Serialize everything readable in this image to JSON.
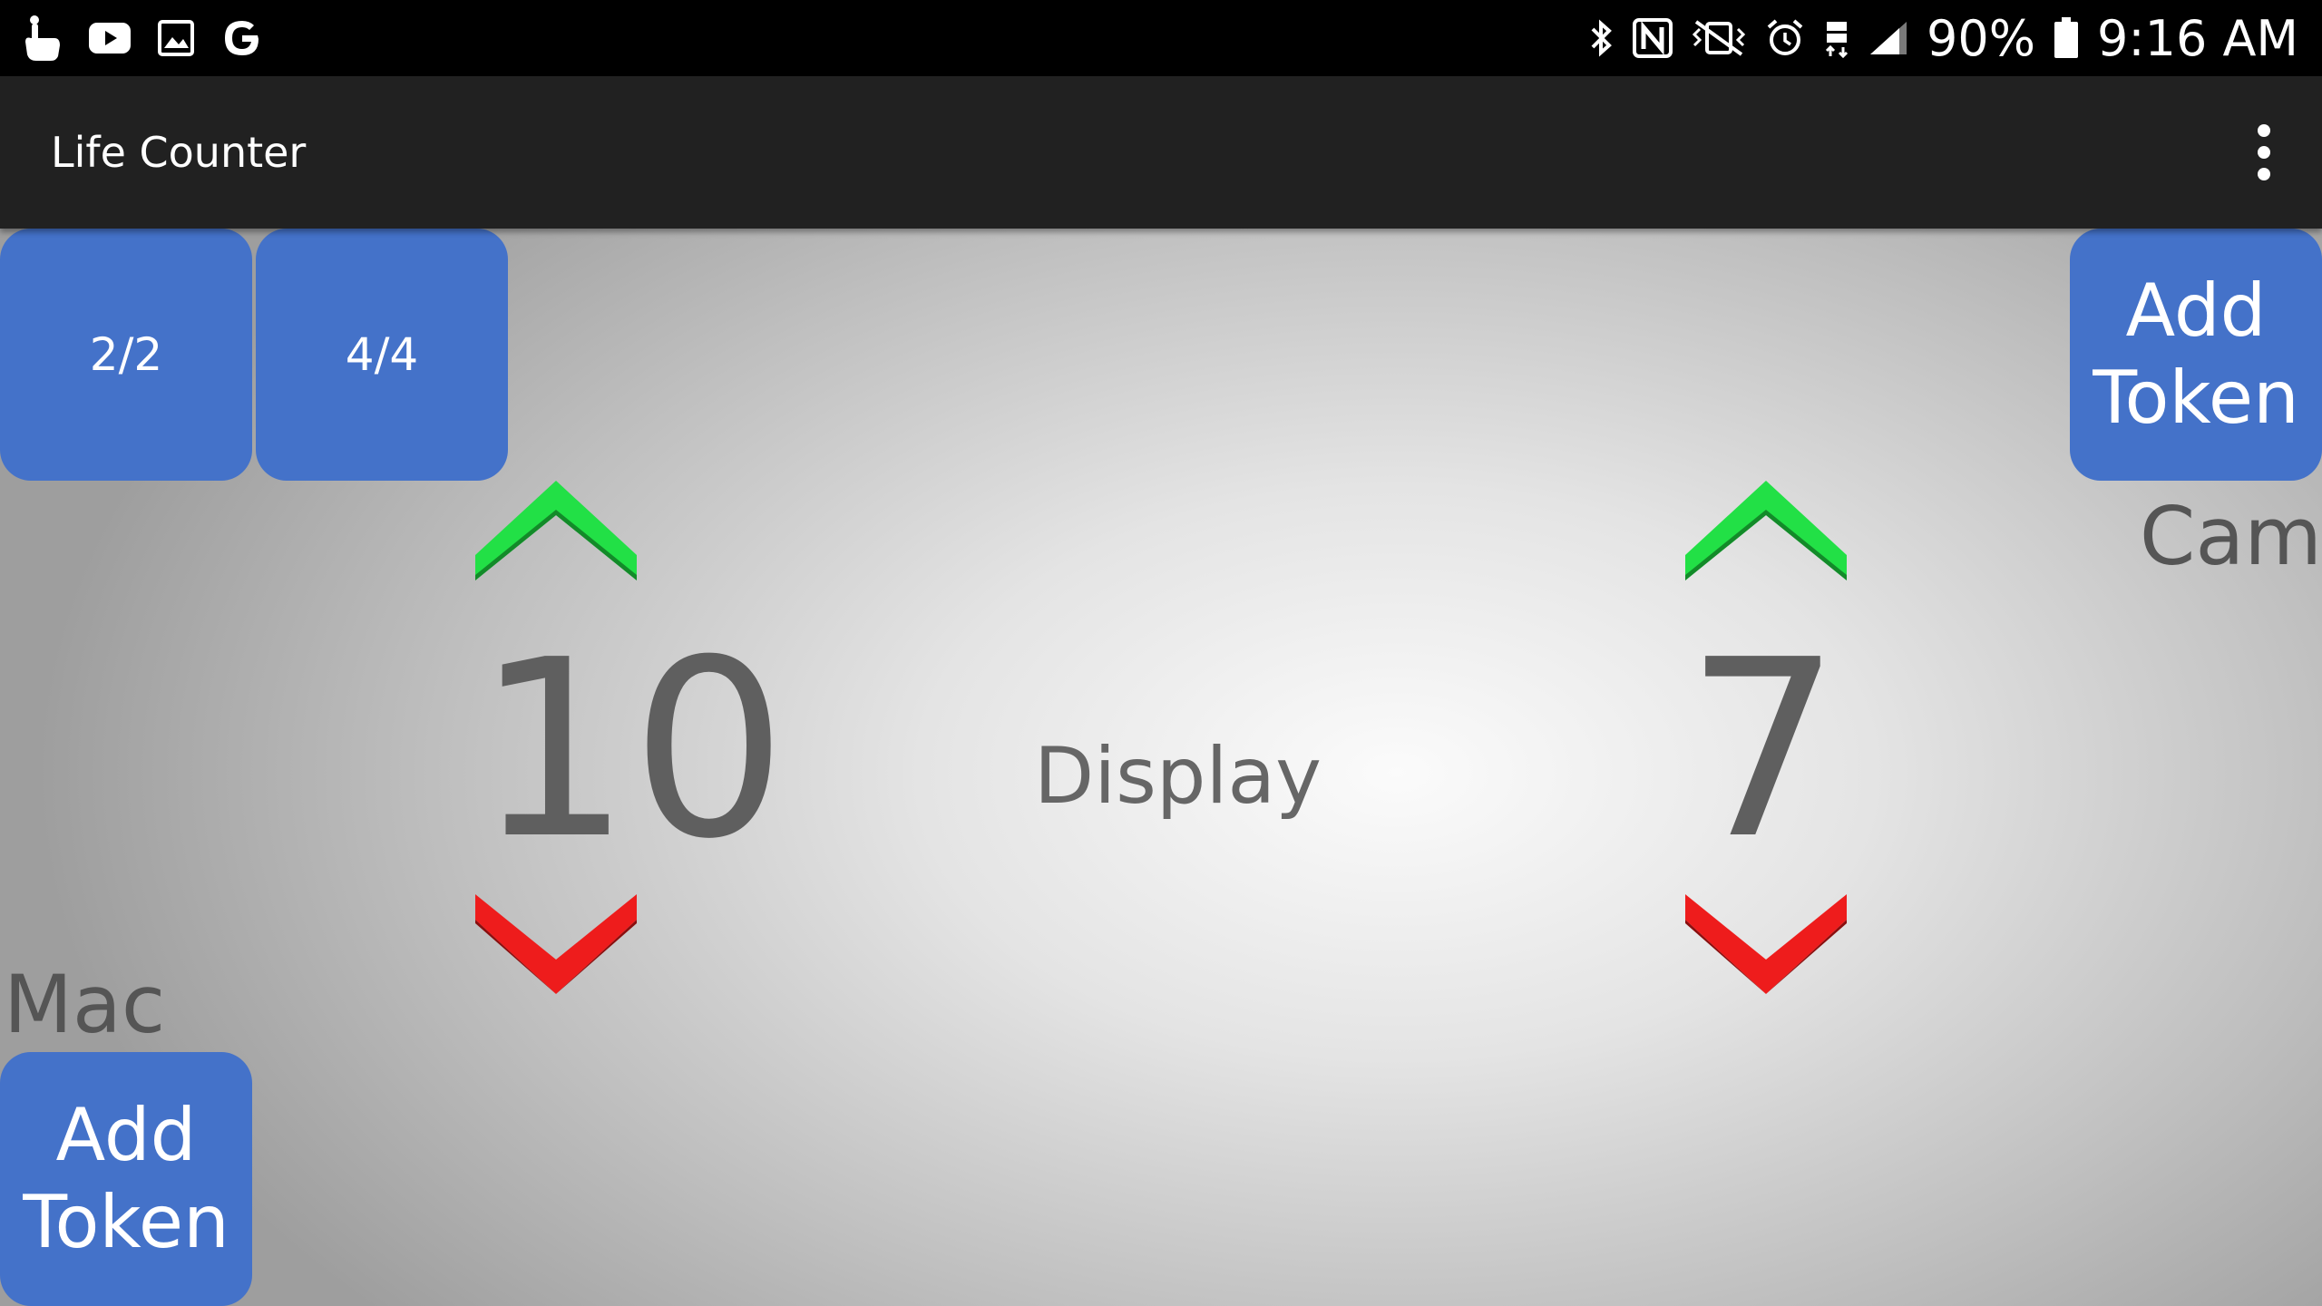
{
  "status_bar": {
    "battery_percent": "90%",
    "time": "9:16 AM",
    "left_icons": [
      "touch-gesture-icon",
      "youtube-icon",
      "gallery-icon",
      "google-icon"
    ],
    "right_icons": [
      "bluetooth-icon",
      "nfc-icon",
      "vibrate-icon",
      "alarm-icon",
      "lte-icon",
      "signal-icon",
      "battery-icon"
    ],
    "battery_level": 0.9
  },
  "app_bar": {
    "title": "Life Counter",
    "menu_icon": "more-vert-icon"
  },
  "toolbar": {
    "preset_1": "2/2",
    "preset_2": "4/4",
    "add_token_top": "Add Token",
    "add_token_bottom": "Add Token"
  },
  "players": [
    {
      "name": "Mac",
      "life": "10"
    },
    {
      "name": "Cam",
      "life": "7"
    }
  ],
  "center": {
    "display_label": "Display"
  },
  "colors": {
    "accent_blue": "#4472c9",
    "increment_green": "#22e046",
    "decrement_red": "#ee1c1c",
    "app_bar": "#212121"
  }
}
